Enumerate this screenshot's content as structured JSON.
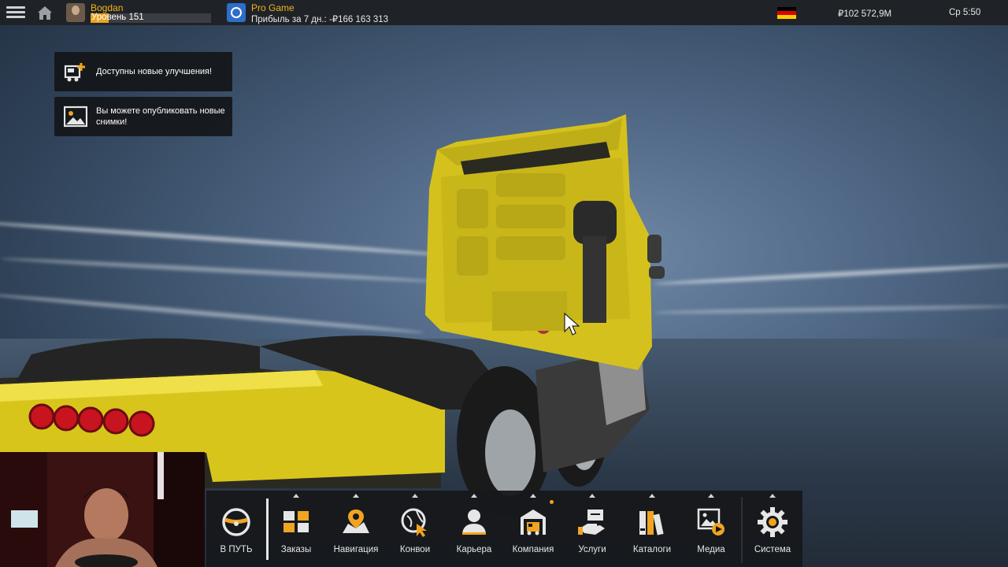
{
  "topbar": {
    "username": "Bogdan",
    "level_label": "Уровень 151",
    "level_progress": 0.15,
    "company_name": "Pro Game",
    "profit_label": "Прибыль за 7 дн.: -₽166 163 313",
    "money": "₽102 572,9M",
    "time": "Ср 5:50",
    "flag_colors": [
      "#000000",
      "#dd0000",
      "#ffce00"
    ]
  },
  "notifications": [
    {
      "text": "Доступны новые улучшения!",
      "icon": "truck-upgrade-icon"
    },
    {
      "text": "Вы можете опубликовать новые снимки!",
      "icon": "screenshot-icon"
    }
  ],
  "dock": {
    "items": [
      {
        "id": "drive",
        "label": "В ПУТЬ",
        "icon": "steering-wheel-icon",
        "has_arrow": false,
        "badge": false
      },
      {
        "id": "jobs",
        "label": "Заказы",
        "icon": "cargo-boxes-icon",
        "has_arrow": true,
        "badge": false
      },
      {
        "id": "navigation",
        "label": "Навигация",
        "icon": "map-pin-icon",
        "has_arrow": true,
        "badge": false
      },
      {
        "id": "convoy",
        "label": "Конвои",
        "icon": "globe-pointer-icon",
        "has_arrow": true,
        "badge": false
      },
      {
        "id": "career",
        "label": "Карьера",
        "icon": "person-icon",
        "has_arrow": true,
        "badge": false
      },
      {
        "id": "company",
        "label": "Компания",
        "icon": "garage-truck-icon",
        "has_arrow": true,
        "badge": true
      },
      {
        "id": "services",
        "label": "Услуги",
        "icon": "handshake-icon",
        "has_arrow": true,
        "badge": false
      },
      {
        "id": "catalogs",
        "label": "Каталоги",
        "icon": "books-icon",
        "has_arrow": true,
        "badge": false
      },
      {
        "id": "media",
        "label": "Медиа",
        "icon": "media-play-icon",
        "has_arrow": true,
        "badge": false
      },
      {
        "id": "system",
        "label": "Система",
        "icon": "gear-icon",
        "has_arrow": true,
        "badge": false
      }
    ]
  },
  "colors": {
    "accent": "#f0a420",
    "topbar_bg": "#1f2327",
    "dock_bg": "#16181b",
    "truck_yellow": "#d6c21c"
  }
}
